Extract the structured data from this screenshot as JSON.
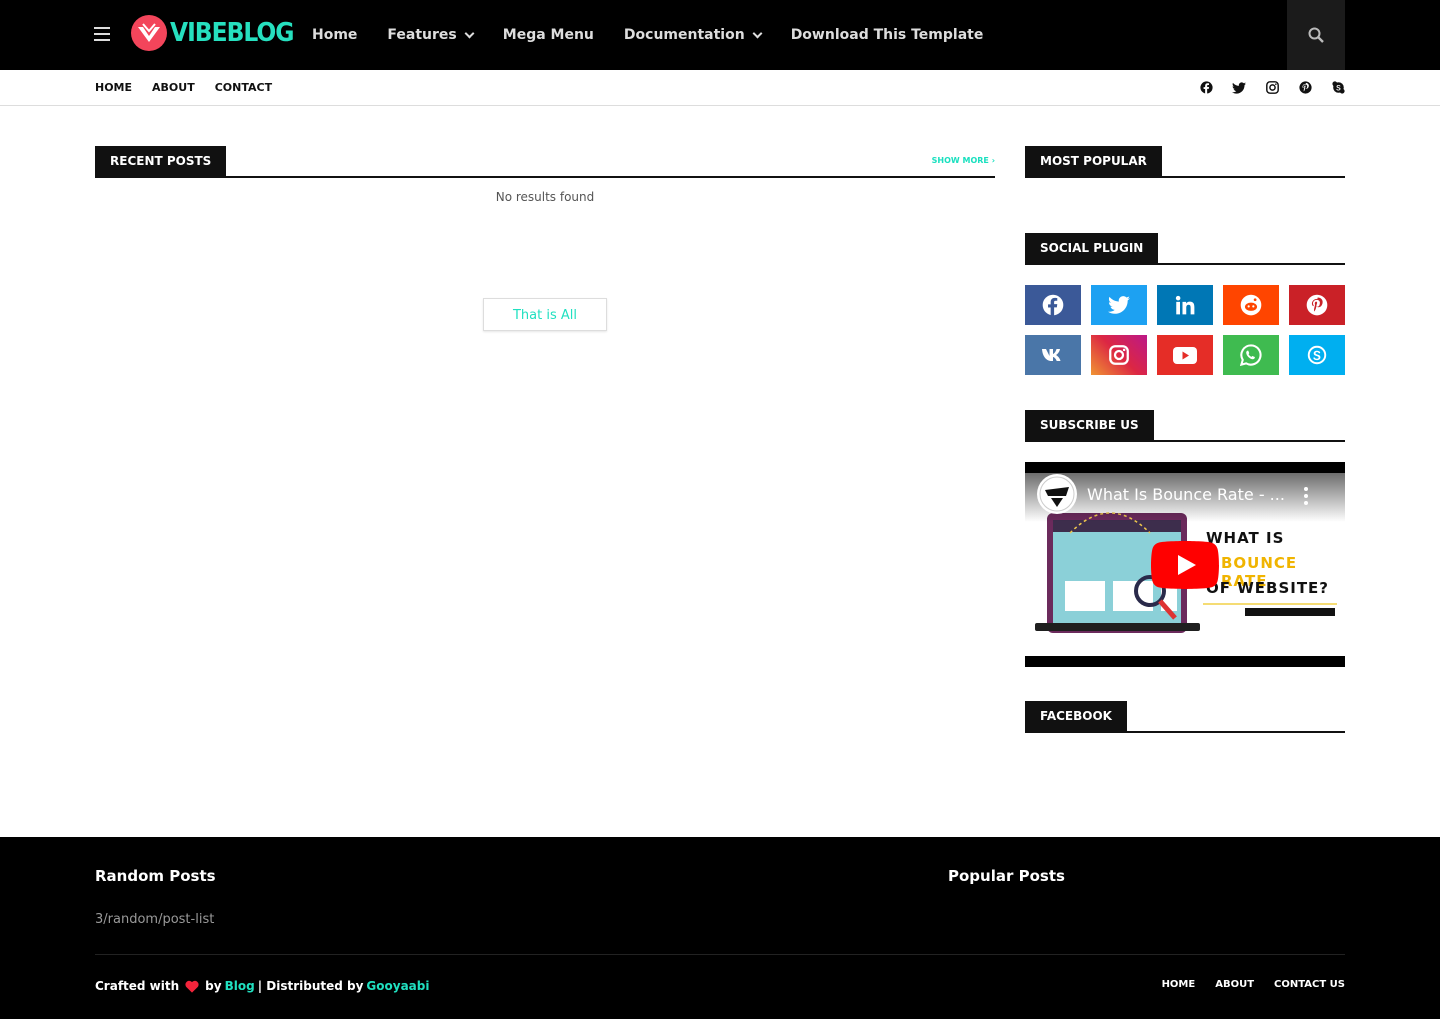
{
  "header": {
    "logo_text": "VIBEBLOG",
    "nav": [
      {
        "label": "Home",
        "has_dropdown": false
      },
      {
        "label": "Features",
        "has_dropdown": true
      },
      {
        "label": "Mega Menu",
        "has_dropdown": false
      },
      {
        "label": "Documentation",
        "has_dropdown": true
      },
      {
        "label": "Download This Template",
        "has_dropdown": false
      }
    ]
  },
  "secondary_nav": [
    "HOME",
    "ABOUT",
    "CONTACT"
  ],
  "social_top": [
    "facebook-icon",
    "twitter-icon",
    "instagram-icon",
    "pinterest-icon",
    "skype-icon"
  ],
  "main": {
    "recent_title": "RECENT POSTS",
    "show_more": "SHOW MORE",
    "no_results": "No results found",
    "thats_all": "That is All"
  },
  "sidebar": {
    "most_popular_title": "MOST POPULAR",
    "social_plugin_title": "SOCIAL PLUGIN",
    "social_buttons": [
      {
        "icon": "facebook-icon",
        "color": "#3b5998"
      },
      {
        "icon": "twitter-icon",
        "color": "#1da1f2"
      },
      {
        "icon": "linkedin-icon",
        "color": "#0077b5"
      },
      {
        "icon": "reddit-icon",
        "color": "#ff4500"
      },
      {
        "icon": "pinterest-icon",
        "color": "#ca2127"
      },
      {
        "icon": "vk-icon",
        "color": "#4a76a8"
      },
      {
        "icon": "instagram-icon",
        "color": "#c13584"
      },
      {
        "icon": "youtube-icon",
        "color": "#e52d27"
      },
      {
        "icon": "whatsapp-icon",
        "color": "#3fbb50"
      },
      {
        "icon": "skype-icon",
        "color": "#00aff0"
      }
    ],
    "subscribe_title": "SUBSCRIBE US",
    "video_title": "What Is Bounce Rate - ...",
    "video_heading": [
      "WHAT IS",
      "BOUNCE RATE",
      "OF WEBSITE?"
    ],
    "facebook_title": "FACEBOOK"
  },
  "footer": {
    "random_title": "Random Posts",
    "random_sub": "3/random/post-list",
    "popular_title": "Popular Posts",
    "crafted_with": "Crafted with",
    "by": "by",
    "blog": "Blog",
    "distributed": "| Distributed by",
    "gooyaabi": "Gooyaabi",
    "nav": [
      "HOME",
      "ABOUT",
      "CONTACT US"
    ]
  },
  "colors": {
    "accent": "#20e0c0",
    "logo_red": "#f3455b",
    "dark": "#111111"
  }
}
